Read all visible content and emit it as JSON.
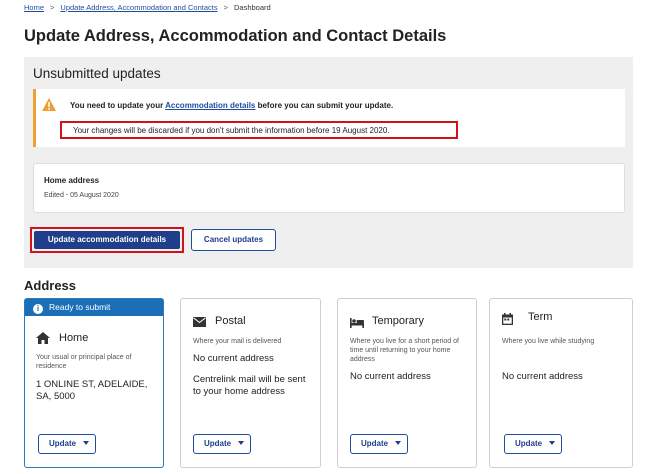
{
  "breadcrumb": {
    "items": [
      "Home",
      "Update Address, Accommodation and Contacts",
      "Dashboard"
    ],
    "separator": ">"
  },
  "page_title": "Update Address, Accommodation and Contact Details",
  "unsubmitted": {
    "title": "Unsubmitted updates",
    "warning": {
      "prefix": "You need to update your ",
      "link": "Accommodation details",
      "suffix": " before you can submit your update.",
      "discard_notice": "Your changes will be discarded if you don't submit the information before 19 August 2020."
    },
    "home_card": {
      "title": "Home address",
      "subtitle": "Edited - 05 August 2020"
    },
    "update_accommodation_label": "Update accommodation details",
    "cancel_label": "Cancel updates"
  },
  "address_section": {
    "title": "Address",
    "cards": [
      {
        "banner": "Ready to submit",
        "icon": "home-icon",
        "title": "Home",
        "description": "Your usual or principal place of residence",
        "value": "1 ONLINE ST, ADELAIDE, SA, 5000",
        "button": "Update"
      },
      {
        "icon": "envelope-icon",
        "title": "Postal",
        "description": "Where your mail is delivered",
        "value": "No current address",
        "note": "Centrelink mail will be sent to your home address",
        "button": "Update"
      },
      {
        "icon": "bed-icon",
        "title": "Temporary",
        "description": "Where you live for a short period of time until returning to your home address",
        "value": "No current address",
        "button": "Update"
      },
      {
        "icon": "calendar-icon",
        "title": "Term",
        "description": "Where you live while studying",
        "value": "No current address",
        "button": "Update"
      }
    ]
  },
  "colors": {
    "primary": "#1f3f8a",
    "link": "#1f4e9c",
    "highlight_border": "#d0121b",
    "warning_accent": "#f0a030",
    "ready_banner": "#1a6fb8",
    "panel_bg": "#efefef"
  }
}
